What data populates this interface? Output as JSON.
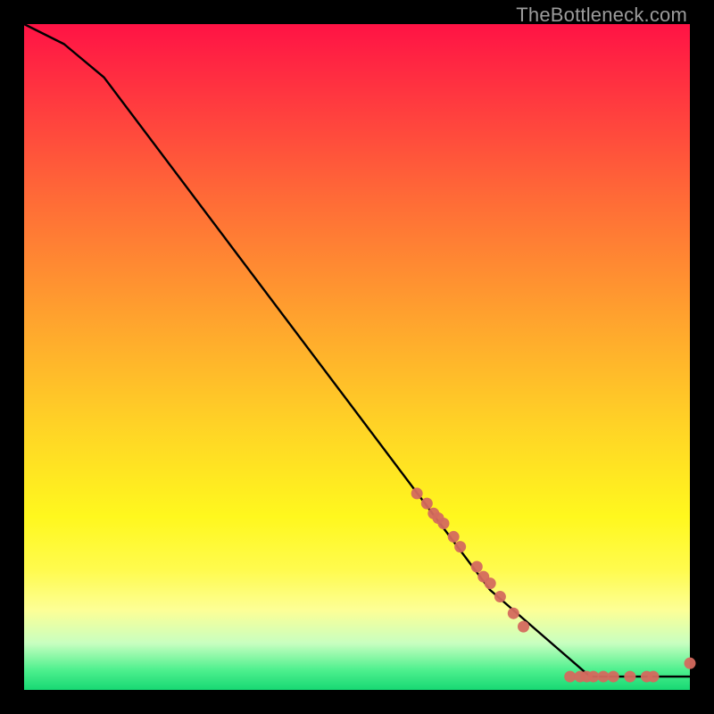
{
  "attribution": "TheBottleneck.com",
  "chart_data": {
    "type": "line",
    "title": "",
    "xlabel": "",
    "ylabel": "",
    "xlim": [
      0,
      100
    ],
    "ylim": [
      0,
      100
    ],
    "grid": false,
    "legend": false,
    "line": {
      "x": [
        0,
        6,
        12,
        70,
        85,
        100
      ],
      "y": [
        100,
        97,
        92,
        15,
        2,
        2
      ]
    },
    "scatter": {
      "x": [
        59,
        60.5,
        61.5,
        62.2,
        63,
        64.5,
        65.5,
        68,
        69,
        70,
        71.5,
        73.5,
        75,
        82,
        83.5,
        84.5,
        85.5,
        87,
        88.5,
        91,
        93.5,
        94.5,
        100
      ],
      "y": [
        29.5,
        28,
        26.5,
        25.8,
        25,
        23,
        21.5,
        18.5,
        17,
        16,
        14,
        11.5,
        9.5,
        2,
        2,
        2,
        2,
        2,
        2,
        2,
        2,
        2,
        4
      ]
    },
    "marker_color": "#d46a5e",
    "line_color": "#000000"
  }
}
